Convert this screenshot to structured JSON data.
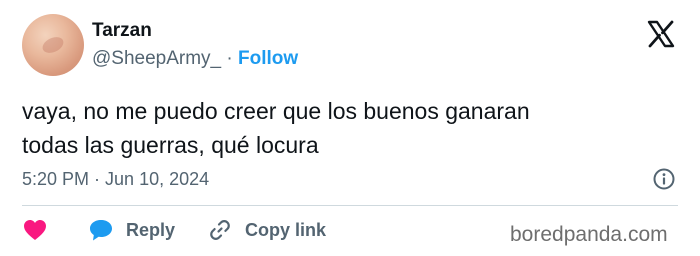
{
  "author": {
    "name": "Tarzan",
    "handle": "@SheepArmy_",
    "separator": " · ",
    "follow_label": "Follow"
  },
  "tweet": {
    "text_line1": "vaya, no me puedo creer que los buenos ganaran",
    "text_line2": "todas las guerras, qué locura"
  },
  "meta": {
    "time": "5:20 PM",
    "separator": " · ",
    "date": "Jun 10, 2024"
  },
  "actions": {
    "reply_label": "Reply",
    "copy_link_label": "Copy link"
  },
  "icons": {
    "platform": "x-logo-icon",
    "info": "info-icon",
    "like": "heart-icon",
    "reply": "reply-bubble-icon",
    "copy": "link-icon"
  },
  "colors": {
    "accent": "#1d9bf0",
    "like": "#f91880",
    "muted_text": "#536471",
    "text": "#0f1419"
  },
  "watermark": "boredpanda.com"
}
